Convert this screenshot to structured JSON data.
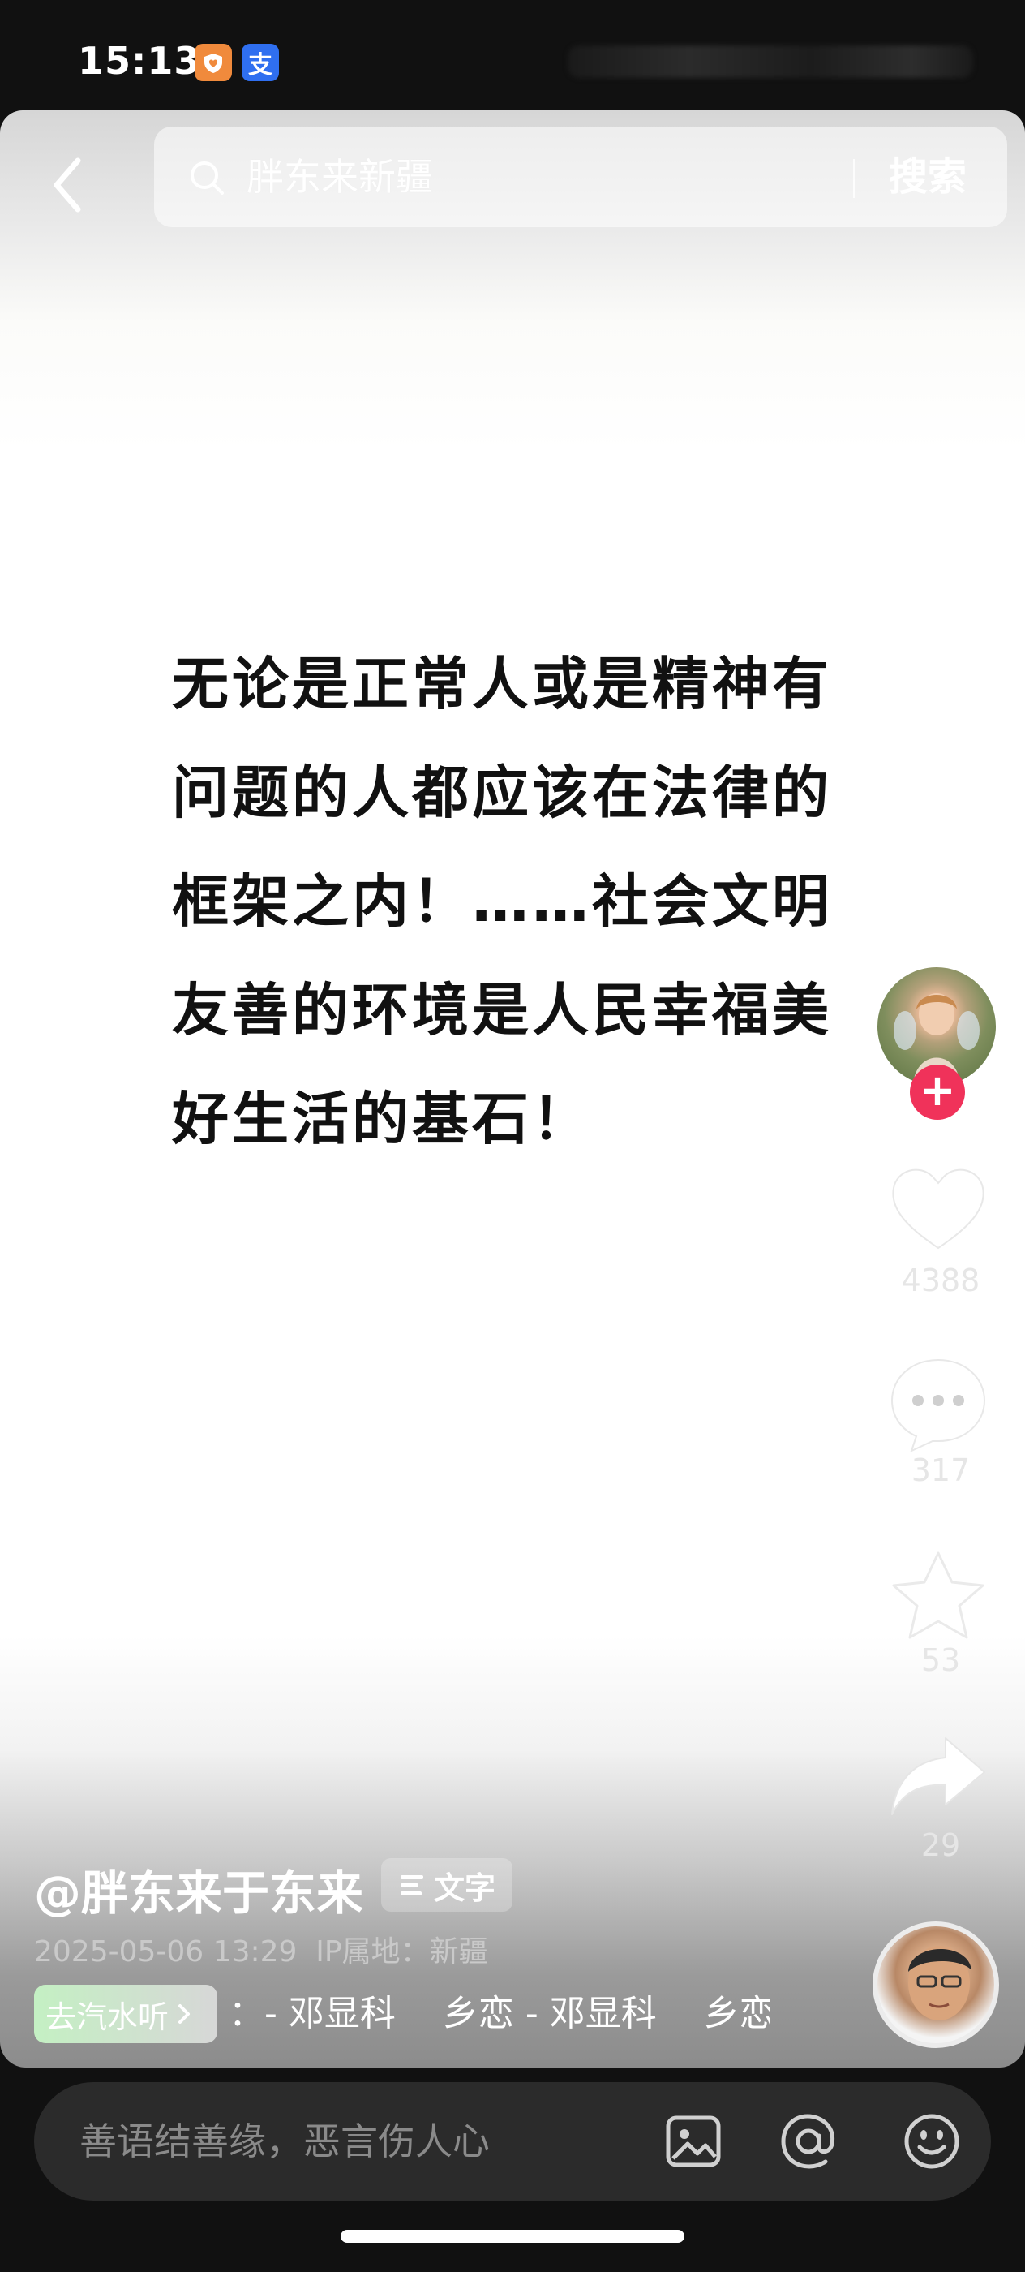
{
  "status_bar": {
    "time": "15:13",
    "app_icons": [
      {
        "icon": "heart-shield-icon",
        "color": "#f08a3c",
        "glyph": "♥"
      },
      {
        "icon": "alipay-icon",
        "color": "#2f6ff0",
        "glyph": "支"
      }
    ]
  },
  "search": {
    "query": "胖东来新疆",
    "button_label": "搜索"
  },
  "post": {
    "text": "无论是正常人或是精神有问题的人都应该在法律的框架之内！……社会文明友善的环境是人民幸福美好生活的基石！",
    "author": "@胖东来于东来",
    "tag_label": "文字",
    "date": "2025-05-06 13:29",
    "ip_location": "IP属地：新疆"
  },
  "actions": {
    "likes": "4388",
    "comments": "317",
    "favorites": "53",
    "shares": "29"
  },
  "music": {
    "chip_label": "去汽水听",
    "track_text": "：- 邓显科　 乡恋 - 邓显科　 乡恋"
  },
  "comment_bar": {
    "placeholder": "善语结善缘，恶言伤人心"
  },
  "colors": {
    "follow_accent": "#f0325a",
    "bar_background": "#2b2b2b"
  }
}
